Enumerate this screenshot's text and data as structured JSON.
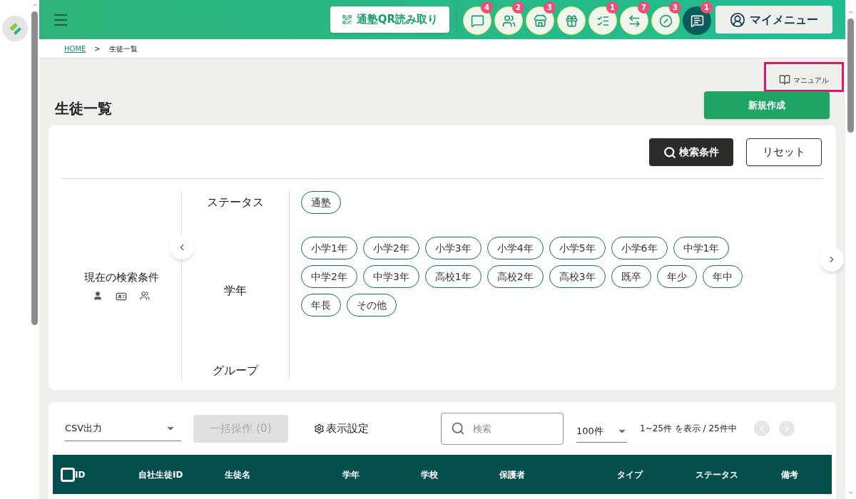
{
  "header": {
    "qr_button": "通塾QR読み取り",
    "icon_buttons": [
      {
        "kind": "round",
        "badge": "4"
      },
      {
        "kind": "round",
        "badge": "2"
      },
      {
        "kind": "round",
        "badge": "3"
      },
      {
        "kind": "round"
      },
      {
        "kind": "round",
        "badge": "1"
      },
      {
        "kind": "round",
        "badge": "7"
      },
      {
        "kind": "round",
        "badge": "3"
      },
      {
        "kind": "dark",
        "badge": "1"
      }
    ],
    "my_menu": "マイメニュー"
  },
  "breadcrumb": [
    {
      "label": "HOME",
      "link": true
    },
    {
      "label": "生徒一覧",
      "link": false
    }
  ],
  "breadcrumb_separator": ">",
  "manual_link": "マニュアル",
  "page_title": "生徒一覧",
  "new_button": "新規作成",
  "search_panel": {
    "search_button": "検索条件",
    "reset_button": "リセット",
    "current_conditions_label": "現在の検索条件",
    "rows": [
      {
        "label": "ステータス",
        "chips": [
          "通塾"
        ]
      },
      {
        "label": "学年",
        "chips": [
          "小学1年",
          "小学2年",
          "小学3年",
          "小学4年",
          "小学5年",
          "小学6年",
          "中学1年",
          "中学2年",
          "中学3年",
          "高校1年",
          "高校2年",
          "高校3年",
          "既卒",
          "年少",
          "年中",
          "年長",
          "その他"
        ]
      },
      {
        "label": "グループ",
        "chips": []
      }
    ]
  },
  "list_toolbar": {
    "csv_select": "CSV出力",
    "bulk_button": "一括操作 (0)",
    "bulk_disabled": true,
    "display_settings": "表示設定",
    "search_placeholder": "検索",
    "per_page": "100件",
    "range": "1~25件 を表示 / 25件中"
  },
  "table": {
    "select_all_checked": false,
    "columns": [
      "ID",
      "自社生徒ID",
      "生徒名",
      "学年",
      "学校",
      "保護者",
      "タイプ",
      "ステータス",
      "備考"
    ]
  }
}
